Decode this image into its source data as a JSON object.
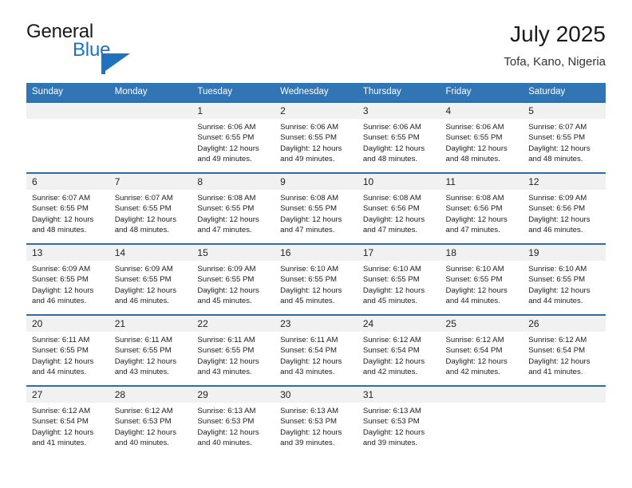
{
  "brand": {
    "word1": "General",
    "word2": "Blue",
    "mark": "flag-triangle-logo",
    "accent": "#1f72bd"
  },
  "header": {
    "title": "July 2025",
    "location": "Tofa, Kano, Nigeria",
    "header_bg": "#3275b4",
    "row_rule": "#2e6da4",
    "daynum_bg": "#f1f1f1"
  },
  "weekday_headers": [
    "Sunday",
    "Monday",
    "Tuesday",
    "Wednesday",
    "Thursday",
    "Friday",
    "Saturday"
  ],
  "weeks": [
    [
      {
        "day": "",
        "sunrise": "",
        "sunset": "",
        "daylight1": "",
        "daylight2": ""
      },
      {
        "day": "",
        "sunrise": "",
        "sunset": "",
        "daylight1": "",
        "daylight2": ""
      },
      {
        "day": "1",
        "sunrise": "Sunrise: 6:06 AM",
        "sunset": "Sunset: 6:55 PM",
        "daylight1": "Daylight: 12 hours",
        "daylight2": "and 49 minutes."
      },
      {
        "day": "2",
        "sunrise": "Sunrise: 6:06 AM",
        "sunset": "Sunset: 6:55 PM",
        "daylight1": "Daylight: 12 hours",
        "daylight2": "and 49 minutes."
      },
      {
        "day": "3",
        "sunrise": "Sunrise: 6:06 AM",
        "sunset": "Sunset: 6:55 PM",
        "daylight1": "Daylight: 12 hours",
        "daylight2": "and 48 minutes."
      },
      {
        "day": "4",
        "sunrise": "Sunrise: 6:06 AM",
        "sunset": "Sunset: 6:55 PM",
        "daylight1": "Daylight: 12 hours",
        "daylight2": "and 48 minutes."
      },
      {
        "day": "5",
        "sunrise": "Sunrise: 6:07 AM",
        "sunset": "Sunset: 6:55 PM",
        "daylight1": "Daylight: 12 hours",
        "daylight2": "and 48 minutes."
      }
    ],
    [
      {
        "day": "6",
        "sunrise": "Sunrise: 6:07 AM",
        "sunset": "Sunset: 6:55 PM",
        "daylight1": "Daylight: 12 hours",
        "daylight2": "and 48 minutes."
      },
      {
        "day": "7",
        "sunrise": "Sunrise: 6:07 AM",
        "sunset": "Sunset: 6:55 PM",
        "daylight1": "Daylight: 12 hours",
        "daylight2": "and 48 minutes."
      },
      {
        "day": "8",
        "sunrise": "Sunrise: 6:08 AM",
        "sunset": "Sunset: 6:55 PM",
        "daylight1": "Daylight: 12 hours",
        "daylight2": "and 47 minutes."
      },
      {
        "day": "9",
        "sunrise": "Sunrise: 6:08 AM",
        "sunset": "Sunset: 6:55 PM",
        "daylight1": "Daylight: 12 hours",
        "daylight2": "and 47 minutes."
      },
      {
        "day": "10",
        "sunrise": "Sunrise: 6:08 AM",
        "sunset": "Sunset: 6:56 PM",
        "daylight1": "Daylight: 12 hours",
        "daylight2": "and 47 minutes."
      },
      {
        "day": "11",
        "sunrise": "Sunrise: 6:08 AM",
        "sunset": "Sunset: 6:56 PM",
        "daylight1": "Daylight: 12 hours",
        "daylight2": "and 47 minutes."
      },
      {
        "day": "12",
        "sunrise": "Sunrise: 6:09 AM",
        "sunset": "Sunset: 6:56 PM",
        "daylight1": "Daylight: 12 hours",
        "daylight2": "and 46 minutes."
      }
    ],
    [
      {
        "day": "13",
        "sunrise": "Sunrise: 6:09 AM",
        "sunset": "Sunset: 6:55 PM",
        "daylight1": "Daylight: 12 hours",
        "daylight2": "and 46 minutes."
      },
      {
        "day": "14",
        "sunrise": "Sunrise: 6:09 AM",
        "sunset": "Sunset: 6:55 PM",
        "daylight1": "Daylight: 12 hours",
        "daylight2": "and 46 minutes."
      },
      {
        "day": "15",
        "sunrise": "Sunrise: 6:09 AM",
        "sunset": "Sunset: 6:55 PM",
        "daylight1": "Daylight: 12 hours",
        "daylight2": "and 45 minutes."
      },
      {
        "day": "16",
        "sunrise": "Sunrise: 6:10 AM",
        "sunset": "Sunset: 6:55 PM",
        "daylight1": "Daylight: 12 hours",
        "daylight2": "and 45 minutes."
      },
      {
        "day": "17",
        "sunrise": "Sunrise: 6:10 AM",
        "sunset": "Sunset: 6:55 PM",
        "daylight1": "Daylight: 12 hours",
        "daylight2": "and 45 minutes."
      },
      {
        "day": "18",
        "sunrise": "Sunrise: 6:10 AM",
        "sunset": "Sunset: 6:55 PM",
        "daylight1": "Daylight: 12 hours",
        "daylight2": "and 44 minutes."
      },
      {
        "day": "19",
        "sunrise": "Sunrise: 6:10 AM",
        "sunset": "Sunset: 6:55 PM",
        "daylight1": "Daylight: 12 hours",
        "daylight2": "and 44 minutes."
      }
    ],
    [
      {
        "day": "20",
        "sunrise": "Sunrise: 6:11 AM",
        "sunset": "Sunset: 6:55 PM",
        "daylight1": "Daylight: 12 hours",
        "daylight2": "and 44 minutes."
      },
      {
        "day": "21",
        "sunrise": "Sunrise: 6:11 AM",
        "sunset": "Sunset: 6:55 PM",
        "daylight1": "Daylight: 12 hours",
        "daylight2": "and 43 minutes."
      },
      {
        "day": "22",
        "sunrise": "Sunrise: 6:11 AM",
        "sunset": "Sunset: 6:55 PM",
        "daylight1": "Daylight: 12 hours",
        "daylight2": "and 43 minutes."
      },
      {
        "day": "23",
        "sunrise": "Sunrise: 6:11 AM",
        "sunset": "Sunset: 6:54 PM",
        "daylight1": "Daylight: 12 hours",
        "daylight2": "and 43 minutes."
      },
      {
        "day": "24",
        "sunrise": "Sunrise: 6:12 AM",
        "sunset": "Sunset: 6:54 PM",
        "daylight1": "Daylight: 12 hours",
        "daylight2": "and 42 minutes."
      },
      {
        "day": "25",
        "sunrise": "Sunrise: 6:12 AM",
        "sunset": "Sunset: 6:54 PM",
        "daylight1": "Daylight: 12 hours",
        "daylight2": "and 42 minutes."
      },
      {
        "day": "26",
        "sunrise": "Sunrise: 6:12 AM",
        "sunset": "Sunset: 6:54 PM",
        "daylight1": "Daylight: 12 hours",
        "daylight2": "and 41 minutes."
      }
    ],
    [
      {
        "day": "27",
        "sunrise": "Sunrise: 6:12 AM",
        "sunset": "Sunset: 6:54 PM",
        "daylight1": "Daylight: 12 hours",
        "daylight2": "and 41 minutes."
      },
      {
        "day": "28",
        "sunrise": "Sunrise: 6:12 AM",
        "sunset": "Sunset: 6:53 PM",
        "daylight1": "Daylight: 12 hours",
        "daylight2": "and 40 minutes."
      },
      {
        "day": "29",
        "sunrise": "Sunrise: 6:13 AM",
        "sunset": "Sunset: 6:53 PM",
        "daylight1": "Daylight: 12 hours",
        "daylight2": "and 40 minutes."
      },
      {
        "day": "30",
        "sunrise": "Sunrise: 6:13 AM",
        "sunset": "Sunset: 6:53 PM",
        "daylight1": "Daylight: 12 hours",
        "daylight2": "and 39 minutes."
      },
      {
        "day": "31",
        "sunrise": "Sunrise: 6:13 AM",
        "sunset": "Sunset: 6:53 PM",
        "daylight1": "Daylight: 12 hours",
        "daylight2": "and 39 minutes."
      },
      {
        "day": "",
        "sunrise": "",
        "sunset": "",
        "daylight1": "",
        "daylight2": ""
      },
      {
        "day": "",
        "sunrise": "",
        "sunset": "",
        "daylight1": "",
        "daylight2": ""
      }
    ]
  ]
}
